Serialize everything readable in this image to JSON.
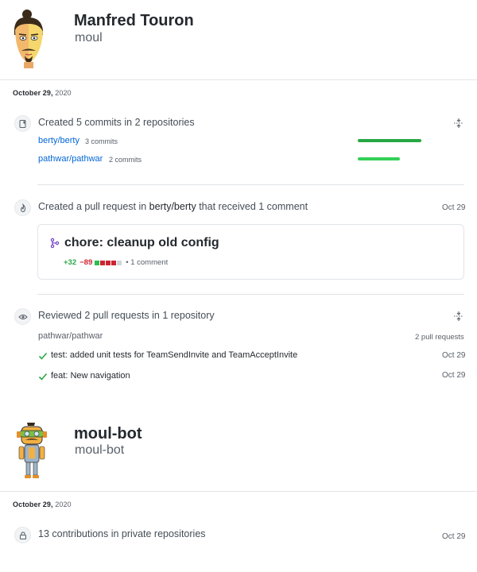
{
  "profile1": {
    "name": "Manfred Touron",
    "login": "moul",
    "date_head": {
      "month_day": "October 29,",
      "year": "2020"
    },
    "commits_event": {
      "title": "Created 5 commits in 2 repositories",
      "repos": [
        {
          "name": "berty/berty",
          "count": "3 commits",
          "bar_fraction": 0.6
        },
        {
          "name": "pathwar/pathwar",
          "count": "2 commits",
          "bar_fraction": 0.4
        }
      ]
    },
    "pr_event": {
      "title_pre": "Created a pull request in ",
      "title_repo": "berty/berty",
      "title_post": " that received 1 comment",
      "date": "Oct 29",
      "card": {
        "title": "chore: cleanup old config",
        "additions": "+32",
        "deletions": "−89",
        "comments": "• 1 comment"
      }
    },
    "review_event": {
      "title": "Reviewed 2 pull requests in 1 repository",
      "repo": "pathwar/pathwar",
      "count": "2 pull requests",
      "items": [
        {
          "label": "test: added unit tests for TeamSendInvite and TeamAcceptInvite",
          "date": "Oct 29"
        },
        {
          "label": "feat: New navigation",
          "date": "Oct 29"
        }
      ]
    }
  },
  "profile2": {
    "name": "moul-bot",
    "login": "moul-bot",
    "date_head": {
      "month_day": "October 29,",
      "year": "2020"
    },
    "private_event": {
      "title": "13 contributions in private repositories",
      "date": "Oct 29"
    }
  },
  "colors": {
    "link": "#0366d6",
    "addition": "#28a745",
    "deletion": "#cb2431",
    "bar": "#28a745"
  }
}
